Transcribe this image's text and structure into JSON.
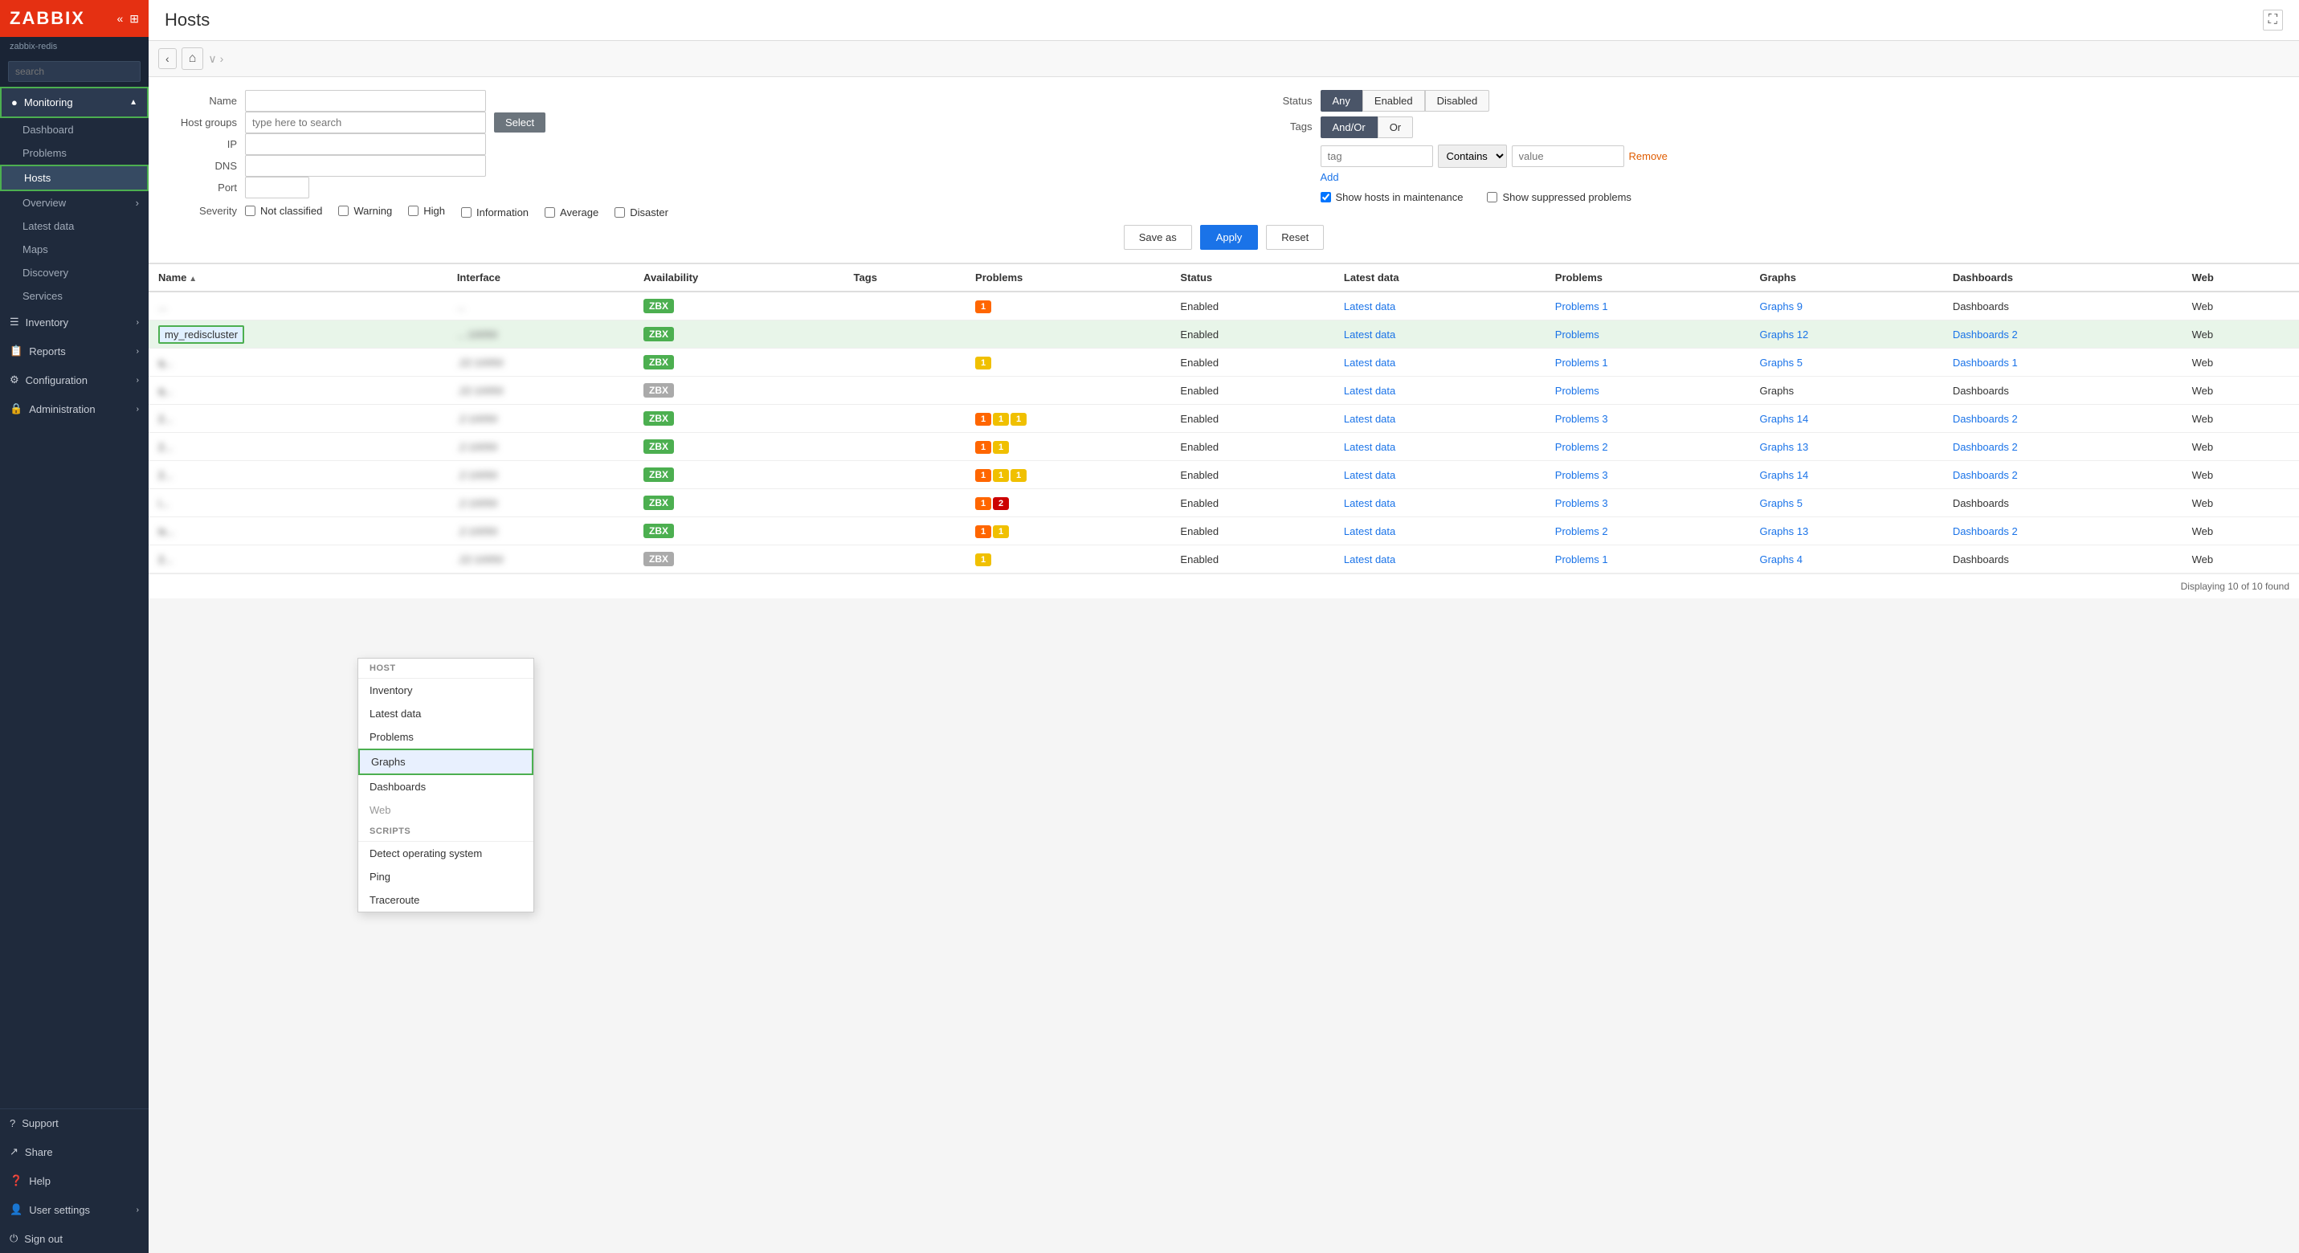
{
  "app": {
    "logo": "ZABBIX",
    "instance": "zabbix-redis",
    "page_title": "Hosts",
    "fullscreen_tooltip": "Fullscreen"
  },
  "sidebar": {
    "search_placeholder": "search",
    "items": [
      {
        "id": "monitoring",
        "label": "Monitoring",
        "icon": "●",
        "active": true,
        "expanded": true
      },
      {
        "id": "dashboard",
        "label": "Dashboard",
        "sub": true
      },
      {
        "id": "problems",
        "label": "Problems",
        "sub": true
      },
      {
        "id": "hosts",
        "label": "Hosts",
        "sub": true,
        "active": true
      },
      {
        "id": "overview",
        "label": "Overview",
        "sub": true,
        "has_arrow": true
      },
      {
        "id": "latest-data",
        "label": "Latest data",
        "sub": true
      },
      {
        "id": "maps",
        "label": "Maps",
        "sub": true
      },
      {
        "id": "discovery",
        "label": "Discovery",
        "sub": true
      },
      {
        "id": "services",
        "label": "Services",
        "sub": true
      },
      {
        "id": "inventory",
        "label": "Inventory",
        "icon": "☰",
        "has_arrow": true
      },
      {
        "id": "reports",
        "label": "Reports",
        "icon": "📋",
        "has_arrow": true
      },
      {
        "id": "configuration",
        "label": "Configuration",
        "icon": "⚙",
        "has_arrow": true
      },
      {
        "id": "administration",
        "label": "Administration",
        "icon": "🔒",
        "has_arrow": true
      },
      {
        "id": "support",
        "label": "Support",
        "icon": "?"
      },
      {
        "id": "share",
        "label": "Share",
        "icon": "↗"
      },
      {
        "id": "help",
        "label": "Help",
        "icon": "❓"
      },
      {
        "id": "user-settings",
        "label": "User settings",
        "icon": "👤",
        "has_arrow": true
      },
      {
        "id": "sign-out",
        "label": "Sign out",
        "icon": "⏻"
      }
    ]
  },
  "filter": {
    "name_label": "Name",
    "name_placeholder": "",
    "host_groups_label": "Host groups",
    "host_groups_placeholder": "type here to search",
    "select_label": "Select",
    "ip_label": "IP",
    "ip_placeholder": "",
    "dns_label": "DNS",
    "dns_placeholder": "",
    "port_label": "Port",
    "port_placeholder": "",
    "status_label": "Status",
    "status_options": [
      "Any",
      "Enabled",
      "Disabled"
    ],
    "status_active": "Any",
    "tags_label": "Tags",
    "tags_options": [
      "And/Or",
      "Or"
    ],
    "tags_active": "And/Or",
    "tag_placeholder": "tag",
    "tag_contains_label": "Contains",
    "tag_value_placeholder": "value",
    "remove_label": "Remove",
    "add_label": "Add",
    "show_maintenance_label": "Show hosts in maintenance",
    "show_suppressed_label": "Show suppressed problems",
    "severity_label": "Severity",
    "severities": [
      {
        "id": "not-classified",
        "label": "Not classified"
      },
      {
        "id": "warning",
        "label": "Warning"
      },
      {
        "id": "high",
        "label": "High"
      },
      {
        "id": "information",
        "label": "Information"
      },
      {
        "id": "average",
        "label": "Average"
      },
      {
        "id": "disaster",
        "label": "Disaster"
      }
    ],
    "save_as_label": "Save as",
    "apply_label": "Apply",
    "reset_label": "Reset"
  },
  "table": {
    "columns": [
      "Name",
      "Interface",
      "Availability",
      "Tags",
      "Problems",
      "Status",
      "Latest data",
      "Problems",
      "Graphs",
      "Dashboards",
      "Web"
    ],
    "footer": "Displaying 10 of 10 found",
    "rows": [
      {
        "name": "...",
        "name_blurred": true,
        "interface": "...",
        "availability": "ZBX",
        "avail_active": true,
        "tags": "",
        "problems": "1",
        "problem_color": "orange",
        "status": "Enabled",
        "latest_data": "Latest data",
        "problems_link": "Problems 1",
        "graphs": "Graphs 9",
        "dashboards": "Dashboards",
        "web": "Web"
      },
      {
        "name": "my_rediscluster",
        "name_highlighted": true,
        "interface": "...:10050",
        "availability": "ZBX",
        "avail_active": true,
        "tags": "",
        "problems": "",
        "problem_color": "",
        "status": "Enabled",
        "latest_data": "Latest data",
        "problems_link": "Problems",
        "graphs": "Graphs 12",
        "dashboards": "Dashboards 2",
        "web": "Web"
      },
      {
        "name": "q...",
        "name_blurred": true,
        "interface": ".22:10050",
        "availability": "ZBX",
        "avail_active": true,
        "tags": "",
        "problems": "1",
        "problem_color": "yellow",
        "status": "Enabled",
        "latest_data": "Latest data",
        "problems_link": "Problems 1",
        "graphs": "Graphs 5",
        "dashboards": "Dashboards 1",
        "web": "Web"
      },
      {
        "name": "q...",
        "name_blurred": true,
        "interface": ".22:10050",
        "availability": "ZBX",
        "avail_active": false,
        "tags": "",
        "problems": "",
        "problem_color": "",
        "status": "Enabled",
        "latest_data": "Latest data",
        "problems_link": "Problems",
        "graphs": "Graphs",
        "dashboards": "Dashboards",
        "web": "Web"
      },
      {
        "name": "2...",
        "name_blurred": true,
        "interface": ".2:10050",
        "availability": "ZBX",
        "avail_active": true,
        "tags": "",
        "problems": "1 1 1",
        "problem_color": "multi3",
        "status": "Enabled",
        "latest_data": "Latest data",
        "problems_link": "Problems 3",
        "graphs": "Graphs 14",
        "dashboards": "Dashboards 2",
        "web": "Web"
      },
      {
        "name": "2...",
        "name_blurred": true,
        "interface": ".2:10050",
        "availability": "ZBX",
        "avail_active": true,
        "tags": "",
        "problems": "1 1",
        "problem_color": "multi2",
        "status": "Enabled",
        "latest_data": "Latest data",
        "problems_link": "Problems 2",
        "graphs": "Graphs 13",
        "dashboards": "Dashboards 2",
        "web": "Web"
      },
      {
        "name": "2...",
        "name_blurred": true,
        "interface": ".2:10050",
        "availability": "ZBX",
        "avail_active": true,
        "tags": "",
        "problems": "1 1 1",
        "problem_color": "multi3",
        "status": "Enabled",
        "latest_data": "Latest data",
        "problems_link": "Problems 3",
        "graphs": "Graphs 14",
        "dashboards": "Dashboards 2",
        "web": "Web"
      },
      {
        "name": "i...",
        "name_blurred": true,
        "interface": ".2:10050",
        "availability": "ZBX",
        "avail_active": true,
        "tags": "",
        "problems": "1 2",
        "problem_color": "multi_red",
        "status": "Enabled",
        "latest_data": "Latest data",
        "problems_link": "Problems 3",
        "graphs": "Graphs 5",
        "dashboards": "Dashboards",
        "web": "Web"
      },
      {
        "name": "is...",
        "name_blurred": true,
        "interface": ".2:10050",
        "availability": "ZBX",
        "avail_active": true,
        "tags": "",
        "problems": "1 1",
        "problem_color": "multi2",
        "status": "Enabled",
        "latest_data": "Latest data",
        "problems_link": "Problems 2",
        "graphs": "Graphs 13",
        "dashboards": "Dashboards 2",
        "web": "Web"
      },
      {
        "name": "2...",
        "name_blurred": true,
        "interface": ".22:10050",
        "availability": "ZBX",
        "avail_active": false,
        "tags": "",
        "problems": "1",
        "problem_color": "yellow",
        "status": "Enabled",
        "latest_data": "Latest data",
        "problems_link": "Problems 1",
        "graphs": "Graphs 4",
        "dashboards": "Dashboards",
        "web": "Web"
      }
    ]
  },
  "context_menu": {
    "host_section": "HOST",
    "items_host": [
      {
        "id": "inventory",
        "label": "Inventory"
      },
      {
        "id": "latest-data",
        "label": "Latest data"
      },
      {
        "id": "problems",
        "label": "Problems"
      },
      {
        "id": "graphs",
        "label": "Graphs",
        "active": true
      },
      {
        "id": "dashboards",
        "label": "Dashboards"
      },
      {
        "id": "web",
        "label": "Web",
        "grayed": true
      }
    ],
    "scripts_section": "SCRIPTS",
    "items_scripts": [
      {
        "id": "detect-os",
        "label": "Detect operating system"
      },
      {
        "id": "ping",
        "label": "Ping"
      },
      {
        "id": "traceroute",
        "label": "Traceroute"
      }
    ]
  }
}
